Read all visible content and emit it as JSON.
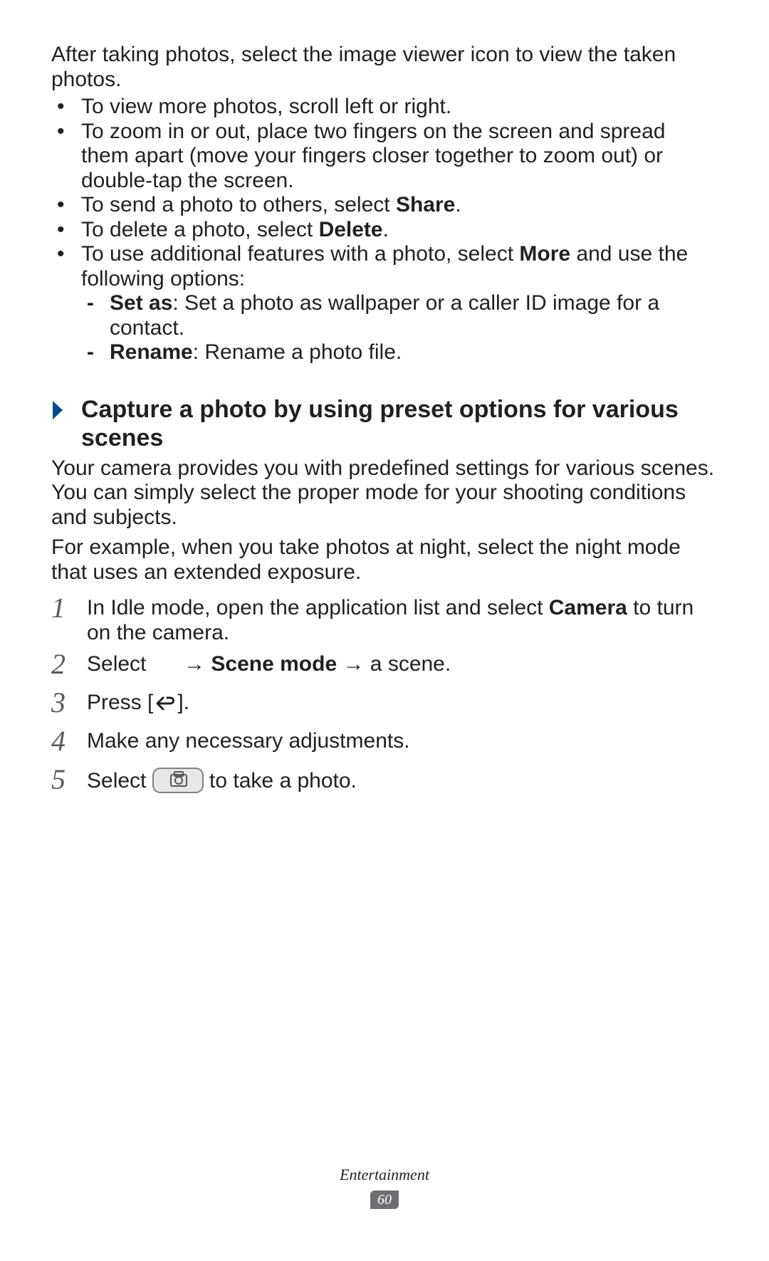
{
  "intro": "After taking photos, select the image viewer icon to view the taken photos.",
  "bullets": [
    {
      "pre": "To view more photos, scroll left or right.",
      "bold": "",
      "post": ""
    },
    {
      "pre": "To zoom in or out, place two fingers on the screen and spread them apart (move your fingers closer together to zoom out) or double-tap the screen.",
      "bold": "",
      "post": ""
    },
    {
      "pre": "To send a photo to others, select ",
      "bold": "Share",
      "post": "."
    },
    {
      "pre": "To delete a photo, select ",
      "bold": "Delete",
      "post": "."
    },
    {
      "pre": "To use additional features with a photo, select ",
      "bold": "More",
      "post": " and use the following options:",
      "sub": [
        {
          "bold": "Set as",
          "post": ": Set a photo as wallpaper or a caller ID image for a contact."
        },
        {
          "bold": "Rename",
          "post": ": Rename a photo file."
        }
      ]
    }
  ],
  "section": {
    "title": "Capture a photo by using preset options for various scenes",
    "para1": "Your camera provides you with predefined settings for various scenes. You can simply select the proper mode for your shooting conditions and subjects.",
    "para2": "For example, when you take photos at night, select the night mode that uses an extended exposure."
  },
  "steps": {
    "s1_pre": "In Idle mode, open the application list and select ",
    "s1_bold": "Camera",
    "s1_post": " to turn on the camera.",
    "s2_pre": "Select ",
    "s2_arrow1": " → ",
    "s2_bold": "Scene mode",
    "s2_arrow2": " → a scene.",
    "s3_pre": "Press [",
    "s3_post": "].",
    "s4": "Make any necessary adjustments.",
    "s5_pre": "Select ",
    "s5_post": " to take a photo."
  },
  "footer": {
    "chapter": "Entertainment",
    "page": "60"
  }
}
